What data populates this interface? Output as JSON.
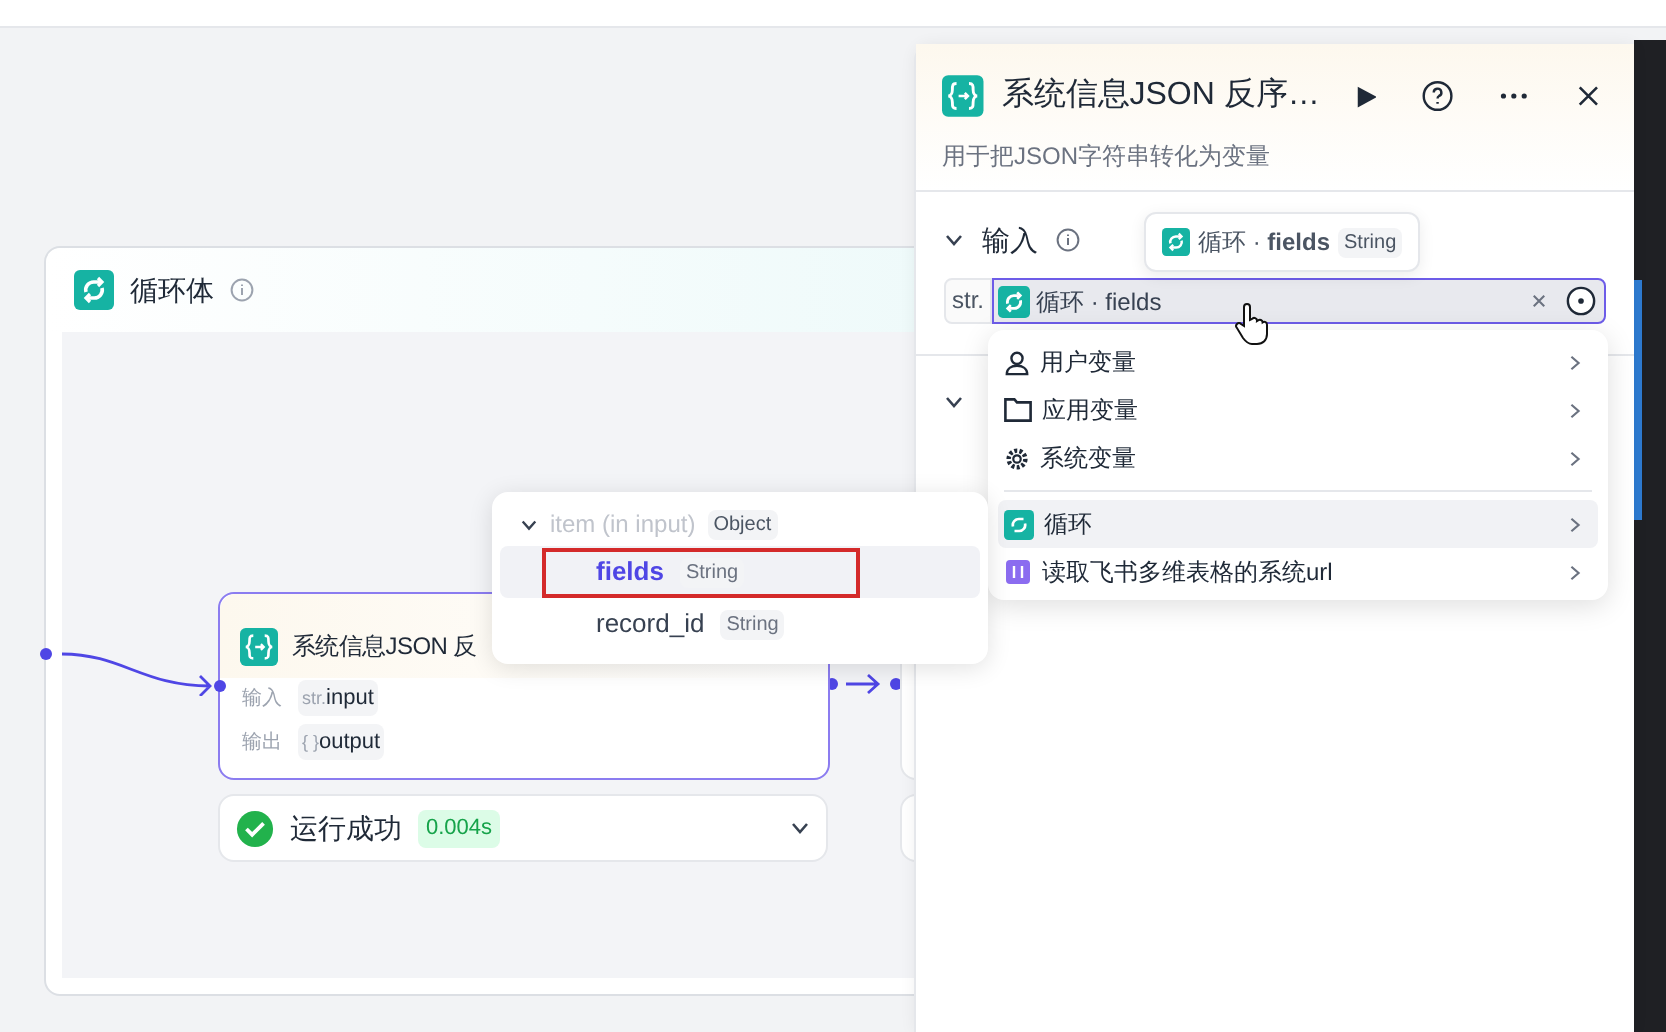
{
  "loop_container": {
    "title": "循环体"
  },
  "node": {
    "title": "系统信息JSON 反",
    "ports": [
      {
        "label": "输入",
        "type": "str.",
        "name": "input"
      },
      {
        "label": "输出",
        "type": "{ }",
        "name": "output"
      }
    ]
  },
  "run_status": {
    "text": "运行成功",
    "duration": "0.004s",
    "success": true
  },
  "variable_tree": {
    "parent": {
      "label": "item (in input)",
      "type": "Object",
      "expanded": true
    },
    "items": [
      {
        "name": "fields",
        "type": "String",
        "selected": true,
        "annotated": true
      },
      {
        "name": "record_id",
        "type": "String",
        "selected": false,
        "annotated": false
      }
    ]
  },
  "panel": {
    "title": "系统信息JSON 反序…",
    "description": "用于把JSON字符串转化为变量",
    "input_section": {
      "label": "输入",
      "expanded": true
    },
    "input_field": {
      "type_prefix": "str.",
      "value": "循环 · fields"
    },
    "tooltip": {
      "text": "循环 · **fields**",
      "type": "String"
    },
    "menu": [
      {
        "kind": "user",
        "label": "用户变量",
        "selected": false
      },
      {
        "kind": "app",
        "label": "应用变量",
        "selected": false
      },
      {
        "kind": "system",
        "label": "系统变量",
        "selected": false
      },
      {
        "kind": "node",
        "label": "循环",
        "color": "#16b3a3",
        "selected": true
      },
      {
        "kind": "node",
        "label": "读取飞书多维表格的系统url",
        "color": "#8b6cf0",
        "selected": false
      }
    ]
  }
}
